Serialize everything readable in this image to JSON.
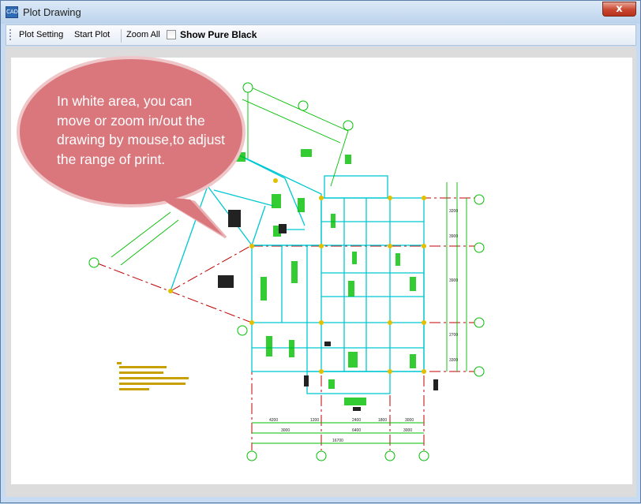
{
  "window": {
    "title": "Plot Drawing",
    "icon_name": "cad-app-icon",
    "close_label": "x"
  },
  "toolbar": {
    "plot_setting_label": "Plot Setting",
    "start_plot_label": "Start Plot",
    "zoom_all_label": "Zoom All",
    "show_pure_black_label": "Show Pure Black",
    "show_pure_black_checked": false
  },
  "callout": {
    "text": "In white area, you can move or zoom in/out the drawing by mouse,to adjust the range of print.",
    "fill_color": "#d9777d"
  },
  "drawing": {
    "line_color": "#00c000",
    "wall_color": "#00c8d2",
    "axis_color": "#c00000",
    "note_color": "#c8a000",
    "bottom_dims_row1": [
      "4200",
      "1200",
      "2400",
      "1800",
      "3000"
    ],
    "bottom_dims_row2": [
      "3000",
      "6400",
      "3000"
    ],
    "bottom_dim_total": "16700",
    "right_dims": [
      "3200",
      "3900",
      "3900",
      "2700",
      "3300"
    ]
  }
}
